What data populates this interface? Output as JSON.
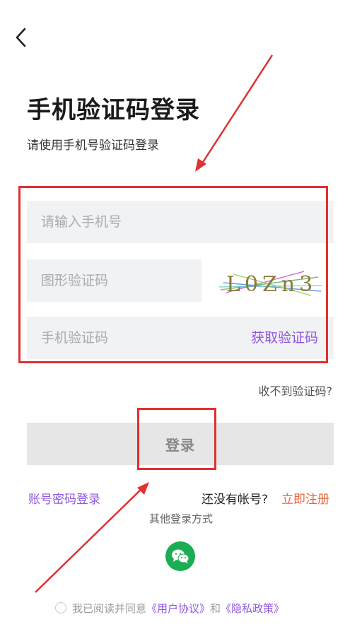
{
  "header": {
    "back_icon": "chevron-left-icon",
    "title": "手机验证码登录",
    "subtitle": "请使用手机号验证码登录"
  },
  "form": {
    "phone_placeholder": "请输入手机号",
    "captcha_placeholder": "图形验证码",
    "captcha_image_text": "L0Zn3",
    "sms_placeholder": "手机验证码",
    "get_code_label": "获取验证码",
    "no_code_label": "收不到验证码?",
    "login_label": "登录"
  },
  "footer": {
    "password_login_label": "账号密码登录",
    "no_account_label": "还没有帐号?",
    "register_label": "立即注册",
    "other_methods_label": "其他登录方式",
    "wechat_icon": "wechat-icon",
    "agreement_prefix": "我已阅读并同意",
    "user_agreement_label": "《用户协议》",
    "and_label": "和",
    "privacy_policy_label": "《隐私政策》"
  },
  "colors": {
    "accent": "#8f56e0",
    "register": "#e8663a",
    "annotation": "#e03030",
    "wechat": "#1aad53",
    "field_bg": "#f1f2f4"
  }
}
